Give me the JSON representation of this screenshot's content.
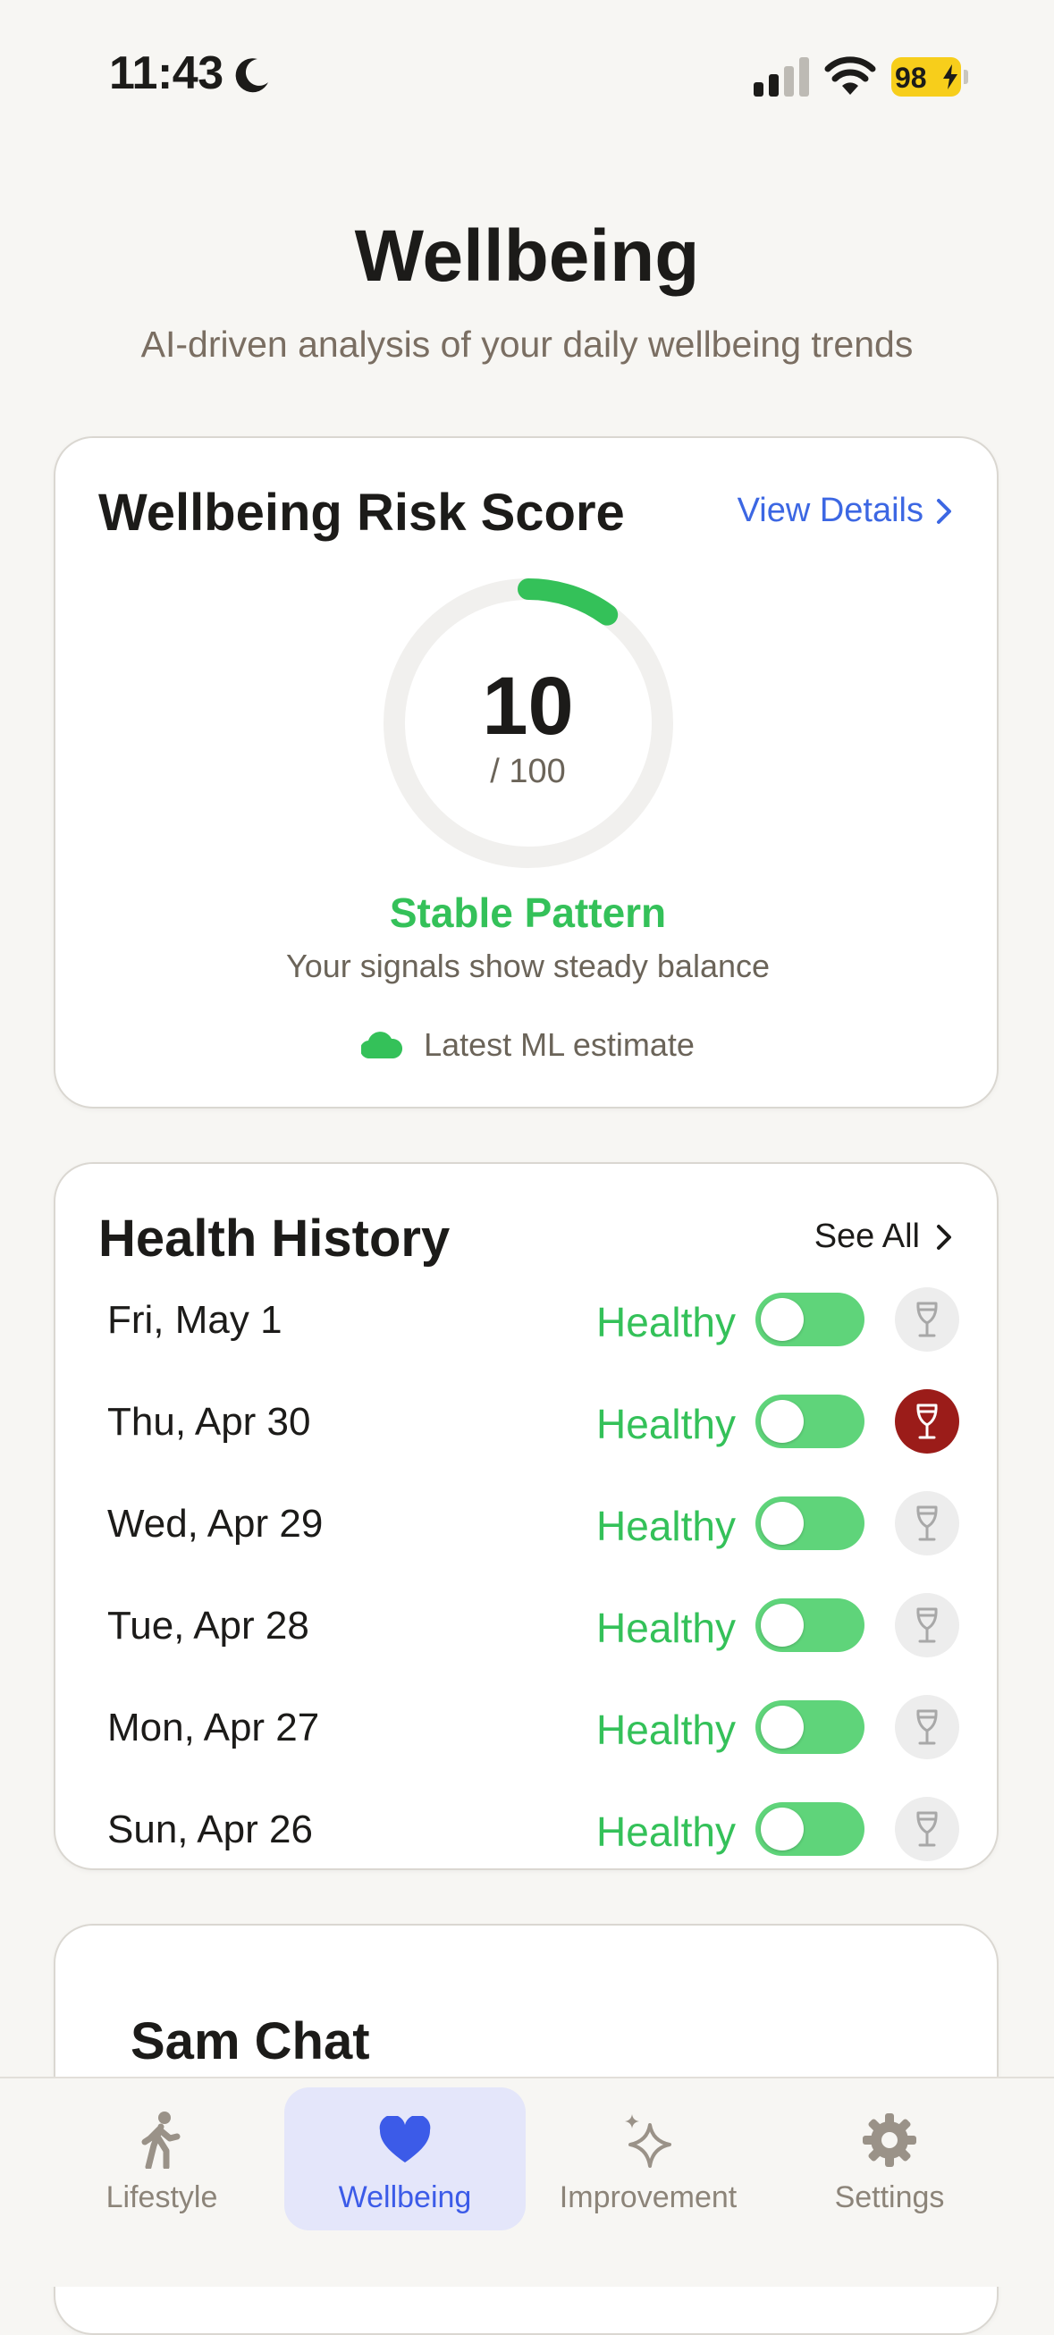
{
  "status_bar": {
    "time": "11:43",
    "battery": "98"
  },
  "header": {
    "title": "Wellbeing",
    "subtitle": "AI-driven analysis of your daily wellbeing trends"
  },
  "risk_card": {
    "title": "Wellbeing Risk Score",
    "view_details": "View Details",
    "score": "10",
    "score_max": "/ 100",
    "score_fraction": 0.1,
    "status": "Stable Pattern",
    "description": "Your signals show steady balance",
    "ml_note": "Latest ML estimate",
    "accent": "#34C159"
  },
  "history_card": {
    "title": "Health History",
    "see_all": "See All",
    "rows": [
      {
        "date": "Fri, May 1",
        "status": "Healthy",
        "toggle_on": true,
        "drink": false
      },
      {
        "date": "Thu, Apr 30",
        "status": "Healthy",
        "toggle_on": true,
        "drink": true
      },
      {
        "date": "Wed, Apr 29",
        "status": "Healthy",
        "toggle_on": true,
        "drink": false
      },
      {
        "date": "Tue, Apr 28",
        "status": "Healthy",
        "toggle_on": true,
        "drink": false
      },
      {
        "date": "Mon, Apr 27",
        "status": "Healthy",
        "toggle_on": true,
        "drink": false
      },
      {
        "date": "Sun, Apr 26",
        "status": "Healthy",
        "toggle_on": true,
        "drink": false
      }
    ]
  },
  "chat_card": {
    "title": "Sam Chat"
  },
  "tabbar": {
    "tabs": [
      {
        "label": "Lifestyle",
        "icon": "walking-figure-icon",
        "active": false
      },
      {
        "label": "Wellbeing",
        "icon": "heart-icon",
        "active": true
      },
      {
        "label": "Improvement",
        "icon": "sparkles-icon",
        "active": false
      },
      {
        "label": "Settings",
        "icon": "gear-icon",
        "active": false
      }
    ]
  }
}
